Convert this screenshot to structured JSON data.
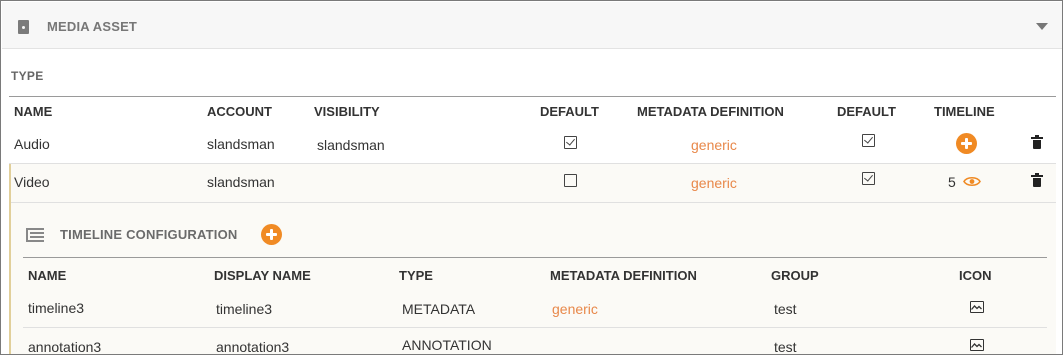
{
  "panel": {
    "title": "MEDIA ASSET",
    "icon": "media-asset-icon",
    "caret_icon": "chevron-down-icon"
  },
  "section": {
    "label": "TYPE"
  },
  "columns": [
    "NAME",
    "ACCOUNT",
    "VISIBILITY",
    "DEFAULT",
    "METADATA DEFINITION",
    "DEFAULT",
    "TIMELINE"
  ],
  "rows": [
    {
      "name": "Audio",
      "account": "slandsman",
      "visibility": "slandsman",
      "default": true,
      "metadata": "generic",
      "default2": true,
      "timeline": "add"
    },
    {
      "name": "Video",
      "account": "slandsman",
      "visibility": "",
      "default": false,
      "metadata": "generic",
      "default2": true,
      "timeline_count": "5"
    }
  ],
  "timeline_config": {
    "title": "TIMELINE CONFIGURATION",
    "columns": [
      "NAME",
      "DISPLAY NAME",
      "TYPE",
      "METADATA DEFINITION",
      "GROUP",
      "ICON"
    ],
    "rows": [
      {
        "name": "timeline3",
        "display": "timeline3",
        "type": "METADATA",
        "metadata": "generic",
        "group": "test",
        "icon": "image-icon"
      },
      {
        "name": "annotation3",
        "display": "annotation3",
        "type": "ANNOTATION",
        "metadata": "",
        "group": "test",
        "icon": "image-icon"
      }
    ]
  },
  "colors": {
    "accent": "#f08a24",
    "link": "#e8884a",
    "band": "#fbfaf6",
    "band_border": "#e1cf9a"
  }
}
